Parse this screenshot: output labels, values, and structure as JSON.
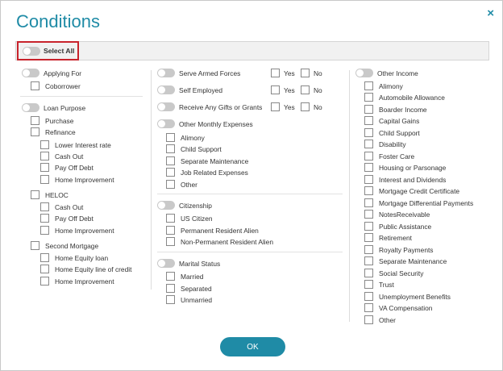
{
  "dialog": {
    "title": "Conditions",
    "close_symbol": "×",
    "ok_label": "OK"
  },
  "select_all": {
    "label": "Select All"
  },
  "col1": {
    "applying_for": {
      "label": "Applying For",
      "items": [
        "Coborrower"
      ]
    },
    "loan_purpose": {
      "label": "Loan Purpose",
      "purchase": "Purchase",
      "refinance": "Refinance",
      "refinance_items": [
        "Lower Interest rate",
        "Cash Out",
        "Pay Off Debt",
        "Home Improvement"
      ],
      "heloc": "HELOC",
      "heloc_items": [
        "Cash Out",
        "Pay Off Debt",
        "Home Improvement"
      ],
      "second_mortgage": "Second Mortgage",
      "second_mortgage_items": [
        "Home Equity loan",
        "Home Equity line of credit",
        "Home Improvement"
      ]
    }
  },
  "col2": {
    "serve_armed_forces": "Serve Armed Forces",
    "self_employed": "Self Employed",
    "receive_gifts": "Receive Any Gifts or Grants",
    "yes": "Yes",
    "no": "No",
    "other_monthly_expenses": {
      "label": "Other Monthly Expenses",
      "items": [
        "Alimony",
        "Child Support",
        "Separate Maintenance",
        "Job Related Expenses",
        "Other"
      ]
    },
    "citizenship": {
      "label": "Citizenship",
      "items": [
        "US Citizen",
        "Permanent Resident Alien",
        "Non-Permanent Resident Alien"
      ]
    },
    "marital_status": {
      "label": "Marital Status",
      "items": [
        "Married",
        "Separated",
        "Unmarried"
      ]
    }
  },
  "col3": {
    "other_income": {
      "label": "Other Income",
      "items": [
        "Alimony",
        "Automobile Allowance",
        "Boarder Income",
        "Capital Gains",
        "Child Support",
        "Disability",
        "Foster Care",
        "Housing or Parsonage",
        "Interest and Dividends",
        "Mortgage Credit Certificate",
        "Mortgage Differential Payments",
        "NotesReceivable",
        "Public Assistance",
        "Retirement",
        "Royalty Payments",
        "Separate Maintenance",
        "Social Security",
        "Trust",
        "Unemployment Benefits",
        "VA Compensation",
        "Other"
      ]
    }
  },
  "colors": {
    "accent": "#1f8ba6",
    "highlight_border": "#c8232c",
    "toggle_off": "#c9c9c9"
  }
}
